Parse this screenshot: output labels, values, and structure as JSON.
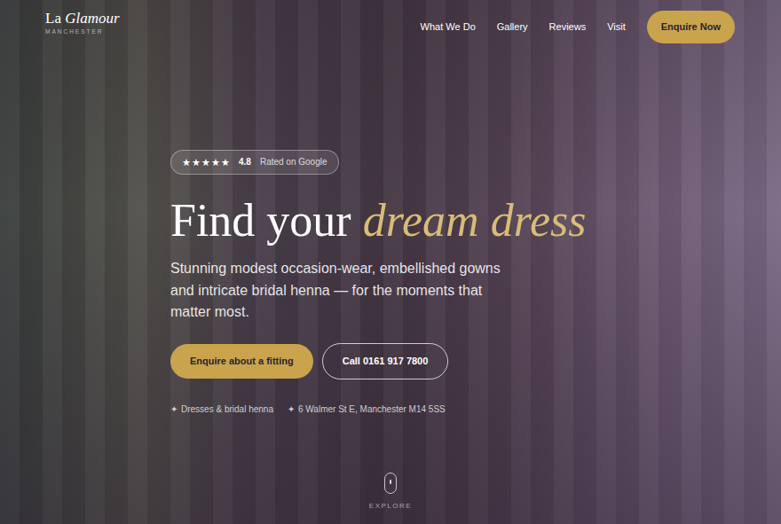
{
  "nav": {
    "brand_a": "La",
    "brand_b": "Glamour",
    "brand_sub": "MANCHESTER",
    "links": [
      "What We Do",
      "Gallery",
      "Reviews",
      "Visit"
    ],
    "cta": "Enquire Now"
  },
  "rating": {
    "stars": 5,
    "star_glyph": "★",
    "score": "4.8",
    "label": "Rated on Google"
  },
  "hero": {
    "title_plain": "Find your ",
    "title_accent": "dream dress",
    "subtitle": "Stunning modest occasion-wear, embellished gowns and intricate bridal henna — for the moments that matter most."
  },
  "buttons": {
    "primary": "Enquire about a fitting",
    "secondary": "Call 0161 917 7800"
  },
  "facts": [
    {
      "icon": "✦",
      "text": "Dresses & bridal henna"
    },
    {
      "icon": "✦",
      "text": "6 Walmer St E, Manchester M14 5SS"
    }
  ],
  "scroll": {
    "label": "EXPLORE"
  }
}
